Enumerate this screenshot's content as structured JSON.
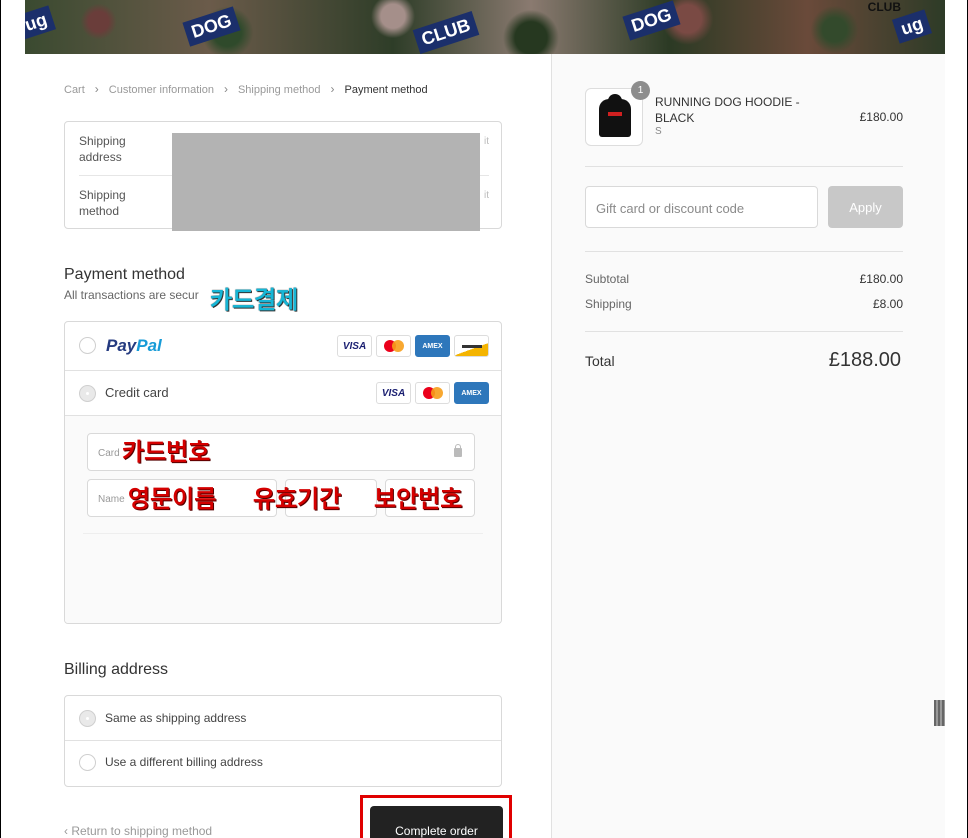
{
  "breadcrumb": {
    "items": [
      "Cart",
      "Customer information",
      "Shipping method",
      "Payment method"
    ],
    "separator": "›"
  },
  "review": {
    "shipping_address_label": "Shipping address",
    "shipping_method_label": "Shipping method",
    "change_label": "it"
  },
  "payment": {
    "title": "Payment method",
    "subtitle": "All transactions are secur",
    "annotation": "카드결제",
    "paypal": {
      "brand_part1": "Pay",
      "brand_part2": "Pal"
    },
    "credit_card_label": "Credit card",
    "cards": [
      "VISA",
      "mastercard",
      "AMEX",
      "other"
    ],
    "card_number_placeholder": "Card",
    "name_placeholder": "Name",
    "annotations": {
      "card_number": "카드번호",
      "name": "영문이름",
      "expiry": "유효기간",
      "security": "보안번호"
    }
  },
  "billing": {
    "title": "Billing address",
    "options": [
      "Same as shipping address",
      "Use a different billing address"
    ],
    "selected": 0
  },
  "footer": {
    "return_link": "‹ Return to shipping method",
    "complete_button": "Complete order"
  },
  "order": {
    "product_name": "RUNNING DOG HOODIE - BLACK",
    "product_variant": "S",
    "product_price": "£180.00",
    "quantity": "1",
    "discount_placeholder": "Gift card or discount code",
    "apply_label": "Apply",
    "subtotal_label": "Subtotal",
    "subtotal_value": "£180.00",
    "shipping_label": "Shipping",
    "shipping_value": "£8.00",
    "total_label": "Total",
    "total_value": "£188.00"
  },
  "banner": {
    "logo_text": "CLUB"
  },
  "colors": {
    "annotation_red": "#d40000",
    "annotation_cyan": "#16b6d6",
    "button_dark": "#222222",
    "highlight_red": "#e00000"
  }
}
